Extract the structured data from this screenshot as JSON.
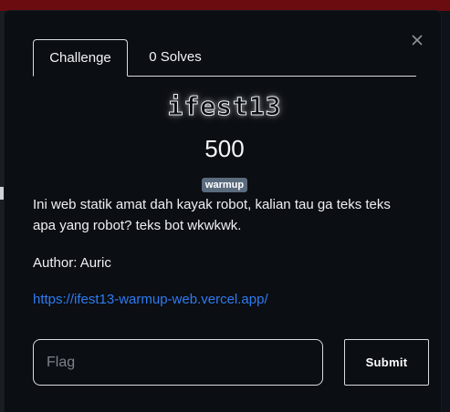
{
  "tabs": [
    {
      "label": "Challenge"
    },
    {
      "label": "0 Solves"
    }
  ],
  "challenge": {
    "name": "ifest13",
    "points": "500",
    "tag": "warmup",
    "description_lines": [
      "Ini web statik amat dah kayak robot, kalian tau ga teks teks",
      "apa yang robot? teks bot wkwkwk."
    ],
    "author": "Author: Auric",
    "link": "https://ifest13-warmup-web.vercel.app/"
  },
  "form": {
    "flag_placeholder": "Flag",
    "submit_label": "Submit"
  },
  "icons": {
    "close": "close-icon"
  },
  "colors": {
    "background": "#0b0e13",
    "top_strip": "#6a0c10",
    "link": "#2f7bf0",
    "tag": "#5b6b7e",
    "border": "#d8dbe0"
  }
}
